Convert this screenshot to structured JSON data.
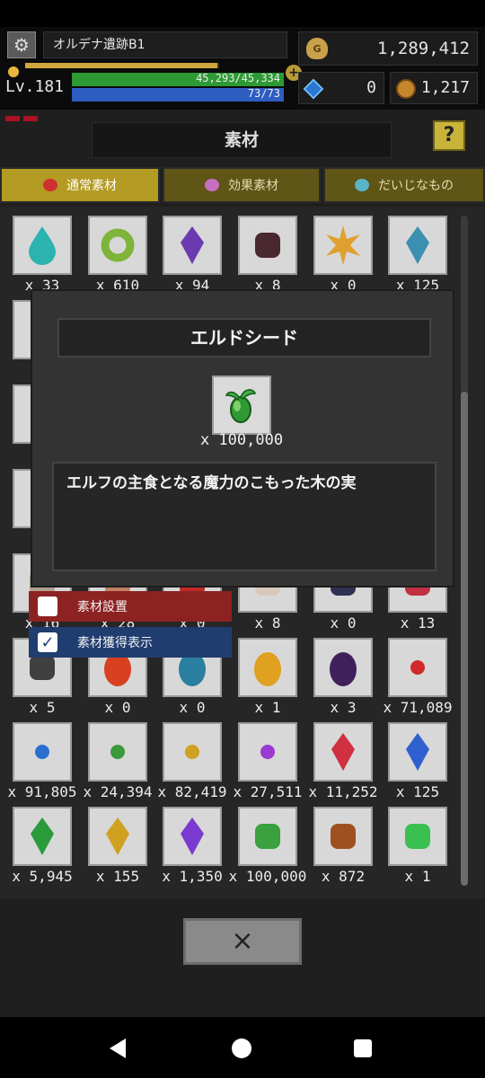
{
  "hud": {
    "location": "オルデナ遺跡B1",
    "gold": "1,289,412",
    "level": "Lv.181",
    "hp": "45,293/45,334",
    "hp_ratio": 0.999,
    "mp": "73/73",
    "mp_ratio": 1.0,
    "exp_ratio": 0.99,
    "gems": "0",
    "medals": "1,217",
    "gold_bag_mark": "G"
  },
  "header": {
    "title": "素材",
    "help_label": "?"
  },
  "tabs": [
    {
      "label": "通常素材",
      "icon": "red-orb-icon",
      "icon_color": "#d03030",
      "active": true
    },
    {
      "label": "効果素材",
      "icon": "bowl-icon",
      "icon_color": "#c66fc0",
      "active": false
    },
    {
      "label": "だいじなもの",
      "icon": "cube-icon",
      "icon_color": "#5ab4c8",
      "active": false
    }
  ],
  "grid": {
    "rows": [
      [
        {
          "icon": "teal-drop-icon",
          "color": "#2bb3b0",
          "count": "x 33"
        },
        {
          "icon": "green-ring-icon",
          "color": "#7fb43a",
          "count": "x 610"
        },
        {
          "icon": "purple-crystal-icon",
          "color": "#6a3bb0",
          "count": "x 94"
        },
        {
          "icon": "dark-rock-icon",
          "color": "#4a2830",
          "count": "x 8"
        },
        {
          "icon": "sun-emblem-icon",
          "color": "#e0a030",
          "count": "x 0"
        },
        {
          "icon": "blue-shard-icon",
          "color": "#3b8fb0",
          "count": "x 125"
        }
      ],
      [
        {
          "icon": "hidden-item-icon",
          "color": "#999",
          "count": ""
        },
        {
          "icon": "hidden-item-icon",
          "color": "#999",
          "count": ""
        },
        {
          "icon": "hidden-item-icon",
          "color": "#999",
          "count": ""
        },
        {
          "icon": "hidden-item-icon",
          "color": "#999",
          "count": ""
        },
        {
          "icon": "hidden-item-icon",
          "color": "#999",
          "count": ""
        },
        {
          "icon": "hidden-item-icon",
          "color": "#999",
          "count": ""
        }
      ],
      [
        {
          "icon": "hidden-item-icon",
          "color": "#999",
          "count": ""
        },
        {
          "icon": "hidden-item-icon",
          "color": "#999",
          "count": ""
        },
        {
          "icon": "hidden-item-icon",
          "color": "#999",
          "count": ""
        },
        {
          "icon": "hidden-item-icon",
          "color": "#999",
          "count": ""
        },
        {
          "icon": "hidden-item-icon",
          "color": "#999",
          "count": ""
        },
        {
          "icon": "hidden-item-icon",
          "color": "#999",
          "count": ""
        }
      ],
      [
        {
          "icon": "hidden-item-icon",
          "color": "#999",
          "count": ""
        },
        {
          "icon": "hidden-item-icon",
          "color": "#999",
          "count": ""
        },
        {
          "icon": "hidden-item-icon",
          "color": "#999",
          "count": ""
        },
        {
          "icon": "hidden-item-icon",
          "color": "#999",
          "count": ""
        },
        {
          "icon": "hidden-item-icon",
          "color": "#999",
          "count": ""
        },
        {
          "icon": "hidden-item-icon",
          "color": "#999",
          "count": ""
        }
      ],
      [
        {
          "icon": "horn-icon",
          "color": "#b0a090",
          "count": "x 16"
        },
        {
          "icon": "claw-icon",
          "color": "#c08060",
          "count": "x 28"
        },
        {
          "icon": "red-chalice-icon",
          "color": "#c02828",
          "count": "x 0"
        },
        {
          "icon": "feather-icon",
          "color": "#d8c8b8",
          "count": "x 8"
        },
        {
          "icon": "dark-orb-icon",
          "color": "#303050",
          "count": "x 0"
        },
        {
          "icon": "red-jar-icon",
          "color": "#c03040",
          "count": "x 13"
        }
      ],
      [
        {
          "icon": "chain-icon",
          "color": "#404040",
          "count": "x 5"
        },
        {
          "icon": "fire-egg-icon",
          "color": "#d84020",
          "count": "x 0"
        },
        {
          "icon": "blue-egg-icon",
          "color": "#2a7fa0",
          "count": "x 0"
        },
        {
          "icon": "gold-egg-icon",
          "color": "#e0a020",
          "count": "x 1"
        },
        {
          "icon": "purple-egg-icon",
          "color": "#40205a",
          "count": "x 3"
        },
        {
          "icon": "red-bead-icon",
          "color": "#d02a2a",
          "count": "x 71,089"
        }
      ],
      [
        {
          "icon": "blue-bead-icon",
          "color": "#2a6fd0",
          "count": "x 91,805"
        },
        {
          "icon": "green-bead-icon",
          "color": "#3a9a3a",
          "count": "x 24,394"
        },
        {
          "icon": "yellow-bead-icon",
          "color": "#d0a020",
          "count": "x 82,419"
        },
        {
          "icon": "purple-bead-icon",
          "color": "#9a3ad0",
          "count": "x 27,511"
        },
        {
          "icon": "red-gem-icon",
          "color": "#d03040",
          "count": "x 11,252"
        },
        {
          "icon": "blue-gem-icon",
          "color": "#3060d0",
          "count": "x 125"
        }
      ],
      [
        {
          "icon": "green-gem-icon",
          "color": "#2a9a3a",
          "count": "x 5,945"
        },
        {
          "icon": "yellow-gem-icon",
          "color": "#d0a020",
          "count": "x 155"
        },
        {
          "icon": "purple-gem-icon",
          "color": "#7a3ad0",
          "count": "x 1,350"
        },
        {
          "icon": "elder-seed-icon",
          "color": "#3aa040",
          "count": "x 100,000"
        },
        {
          "icon": "brown-seed-icon",
          "color": "#a05020",
          "count": "x 872"
        },
        {
          "icon": "green-mascot-icon",
          "color": "#3ac050",
          "count": "x 1"
        }
      ]
    ]
  },
  "options": {
    "place_label": "素材設置",
    "place_checked": false,
    "show_label": "素材獲得表示",
    "show_checked": true,
    "check_mark": "✓"
  },
  "modal": {
    "title": "エルドシード",
    "item_icon": "elder-seed-icon",
    "item_color": "#3aa040",
    "count": "x 100,000",
    "description": "エルフの主食となる魔力のこもった木の実"
  },
  "close_button": {
    "label": "×"
  }
}
